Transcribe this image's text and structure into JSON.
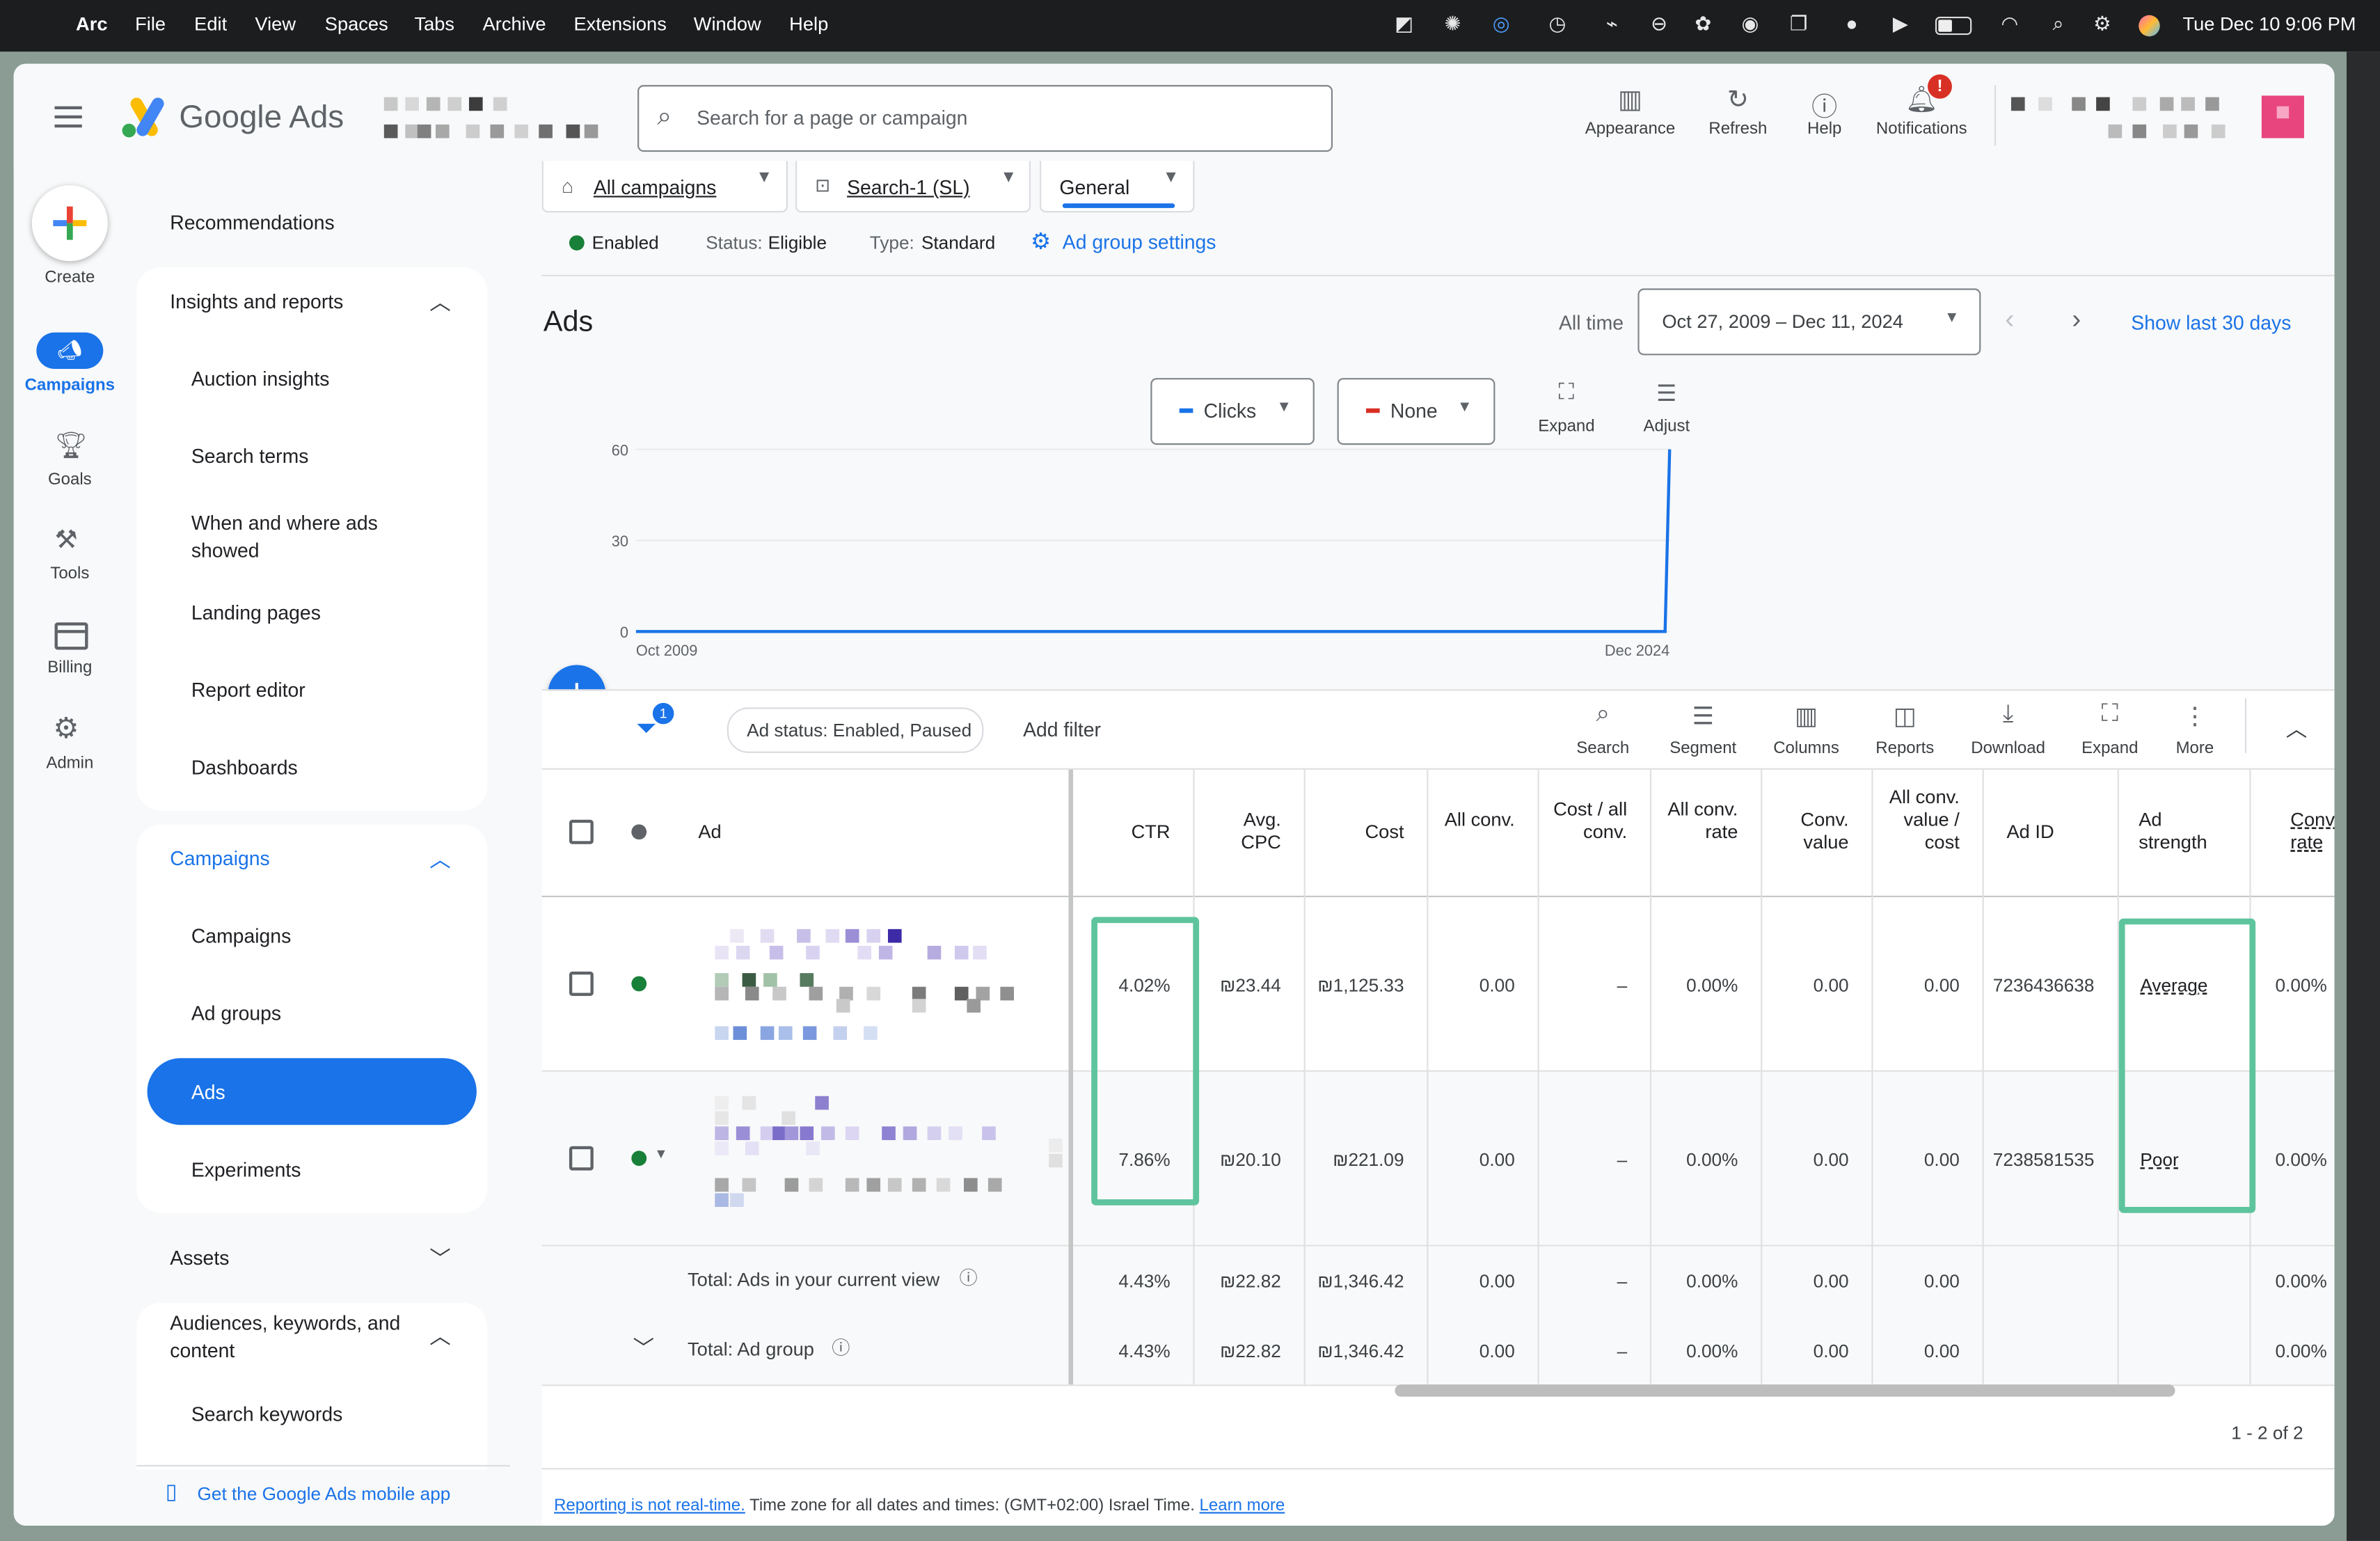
{
  "mac_menu": {
    "items": [
      "Arc",
      "File",
      "Edit",
      "View",
      "Spaces",
      "Tabs",
      "Archive",
      "Extensions",
      "Window",
      "Help"
    ],
    "clock": "Tue Dec 10  9:06 PM"
  },
  "header": {
    "brand": "Google Ads",
    "search_placeholder": "Search for a page or campaign",
    "actions": [
      {
        "label": "Appearance",
        "icon": "appearance-icon"
      },
      {
        "label": "Refresh",
        "icon": "refresh-icon"
      },
      {
        "label": "Help",
        "icon": "help-icon"
      },
      {
        "label": "Notifications",
        "icon": "bell-icon",
        "badge": "!"
      }
    ]
  },
  "rail": {
    "create": "Create",
    "items": [
      {
        "label": "Campaigns",
        "icon": "megaphone-icon",
        "active": true
      },
      {
        "label": "Goals",
        "icon": "trophy-icon"
      },
      {
        "label": "Tools",
        "icon": "tools-icon"
      },
      {
        "label": "Billing",
        "icon": "card-icon"
      },
      {
        "label": "Admin",
        "icon": "gear-icon"
      }
    ]
  },
  "nav": {
    "recommendations": "Recommendations",
    "insights": {
      "title": "Insights and reports",
      "items": [
        "Auction insights",
        "Search terms",
        "When and where ads showed",
        "Landing pages",
        "Report editor",
        "Dashboards"
      ]
    },
    "campaigns": {
      "title": "Campaigns",
      "items": [
        "Campaigns",
        "Ad groups",
        "Ads",
        "Experiments"
      ],
      "active": "Ads"
    },
    "assets": "Assets",
    "audiences": {
      "title": "Audiences, keywords, and content",
      "items": [
        "Search keywords"
      ]
    },
    "mobile_app": "Get the Google Ads mobile app"
  },
  "breadcrumb": {
    "campaigns": "All campaigns",
    "campaign": "Search-1 (SL)",
    "ad_group": "General"
  },
  "status_bar": {
    "enabled": "Enabled",
    "status_label": "Status:",
    "status_value": "Eligible",
    "type_label": "Type:",
    "type_value": "Standard",
    "settings_link": "Ad group settings"
  },
  "page": {
    "title": "Ads",
    "date_preset": "All time",
    "date_range": "Oct 27, 2009 – Dec 11, 2024",
    "show_last": "Show last 30 days"
  },
  "chart_controls": {
    "metric1": "Clicks",
    "metric2": "None",
    "expand": "Expand",
    "adjust": "Adjust",
    "metric1_color": "#1a73e8",
    "metric2_color": "#d93025"
  },
  "chart_data": {
    "type": "line",
    "x": [
      "Oct 2009",
      "Dec 2024"
    ],
    "y_ticks": [
      0,
      30,
      60
    ],
    "ylim": [
      0,
      60
    ],
    "series": [
      {
        "name": "Clicks",
        "values": [
          0,
          60
        ]
      }
    ],
    "xlabel": "",
    "ylabel": ""
  },
  "table_toolbar": {
    "filter_count": "1",
    "filter_chip": "Ad status: Enabled, Paused",
    "add_filter": "Add filter",
    "tools": [
      "Search",
      "Segment",
      "Columns",
      "Reports",
      "Download",
      "Expand",
      "More"
    ]
  },
  "table": {
    "columns": {
      "ad": "Ad",
      "ctr": "CTR",
      "avg_cpc": "Avg. CPC",
      "cost": "Cost",
      "all_conv": "All conv.",
      "cost_all_conv": "Cost / all conv.",
      "all_conv_rate": "All conv. rate",
      "conv_value": "Conv. value",
      "all_conv_value_cost": "All conv. value / cost",
      "ad_id": "Ad ID",
      "ad_strength": "Ad strength",
      "conv_rate": "Conv. rate"
    },
    "rows": [
      {
        "ctr": "4.02%",
        "avg_cpc": "₪23.44",
        "cost": "₪1,125.33",
        "all_conv": "0.00",
        "cost_all_conv": "–",
        "all_conv_rate": "0.00%",
        "conv_value": "0.00",
        "all_conv_value_cost": "0.00",
        "ad_id": "7236436638",
        "ad_strength": "Average",
        "conv_rate": "0.00%"
      },
      {
        "ctr": "7.86%",
        "avg_cpc": "₪20.10",
        "cost": "₪221.09",
        "all_conv": "0.00",
        "cost_all_conv": "–",
        "all_conv_rate": "0.00%",
        "conv_value": "0.00",
        "all_conv_value_cost": "0.00",
        "ad_id": "7238581535",
        "ad_strength": "Poor",
        "conv_rate": "0.00%"
      }
    ],
    "totals": [
      {
        "label": "Total: Ads in your current view",
        "ctr": "4.43%",
        "avg_cpc": "₪22.82",
        "cost": "₪1,346.42",
        "all_conv": "0.00",
        "cost_all_conv": "–",
        "all_conv_rate": "0.00%",
        "conv_value": "0.00",
        "all_conv_value_cost": "0.00",
        "conv_rate": "0.00%"
      },
      {
        "label": "Total: Ad group",
        "ctr": "4.43%",
        "avg_cpc": "₪22.82",
        "cost": "₪1,346.42",
        "all_conv": "0.00",
        "cost_all_conv": "–",
        "all_conv_rate": "0.00%",
        "conv_value": "0.00",
        "all_conv_value_cost": "0.00",
        "conv_rate": "0.00%"
      }
    ],
    "pagination": "1 - 2 of 2"
  },
  "footer": {
    "reporting_link": "Reporting is not real-time.",
    "timezone_text": " Time zone for all dates and times: (GMT+02:00) Israel Time. ",
    "learn_more": "Learn more"
  },
  "colors": {
    "accent": "#1a73e8",
    "highlight_box": "#5ec49d",
    "enabled_dot": "#188038"
  }
}
